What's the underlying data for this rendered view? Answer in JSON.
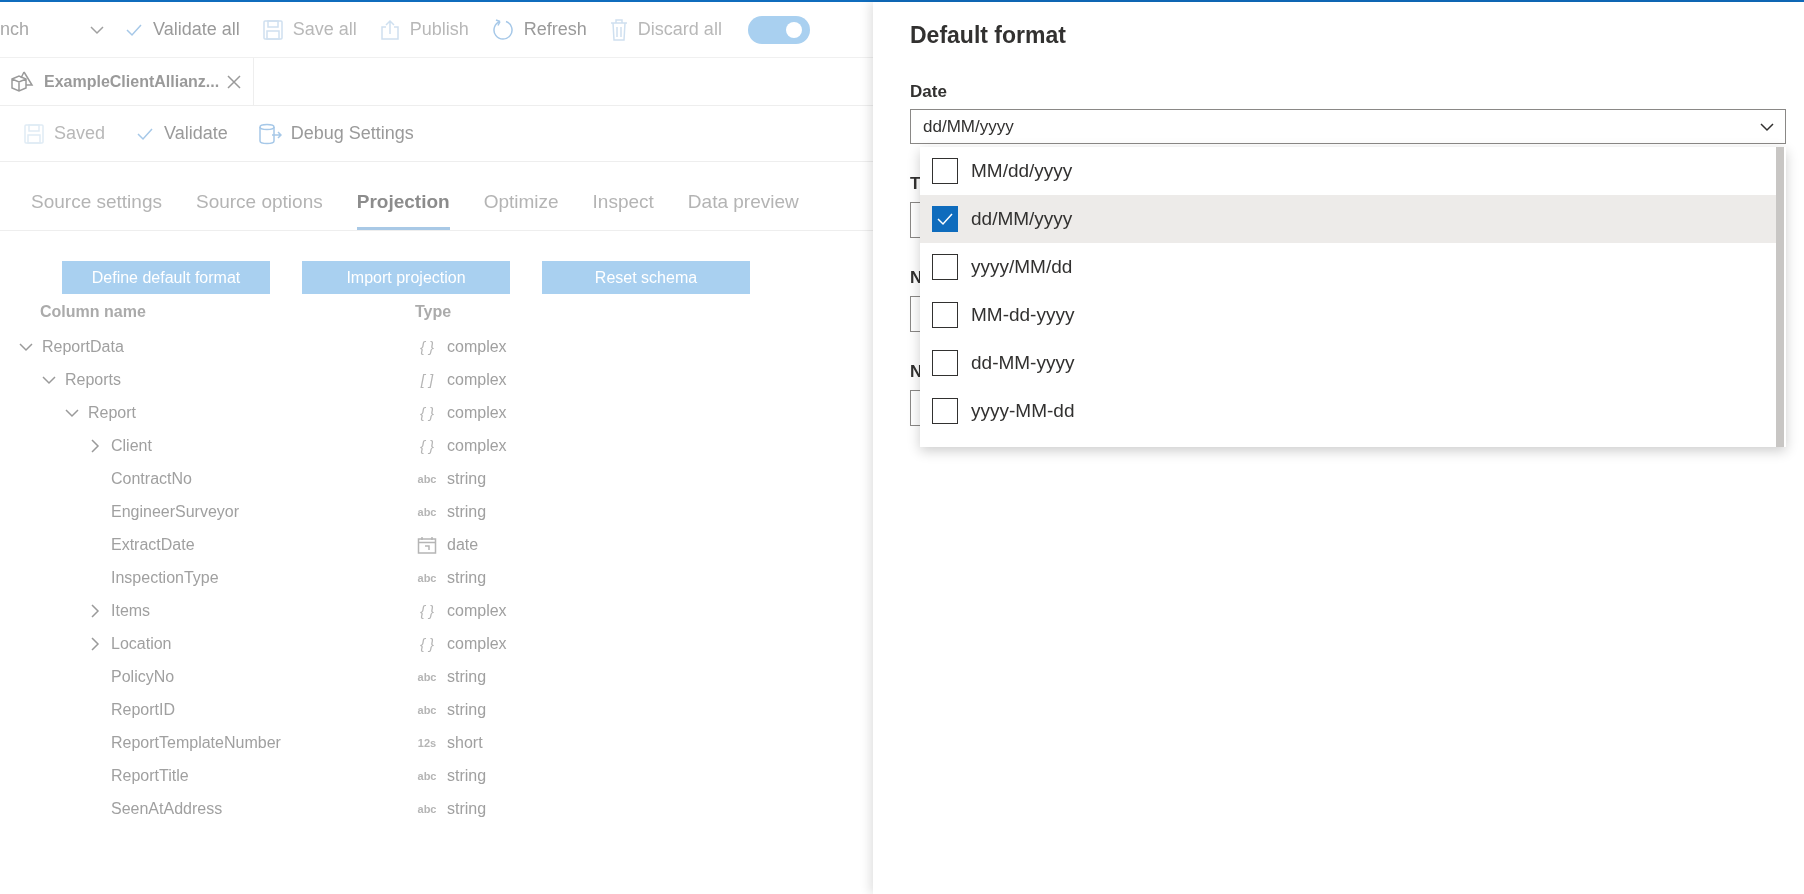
{
  "toolbar": {
    "branch": "nch",
    "items": [
      {
        "kind": "check",
        "label": "Validate all",
        "disabled": false
      },
      {
        "kind": "save",
        "label": "Save all",
        "disabled": true
      },
      {
        "kind": "publish",
        "label": "Publish",
        "disabled": true
      },
      {
        "kind": "refresh",
        "label": "Refresh",
        "disabled": false
      },
      {
        "kind": "trash",
        "label": "Discard all",
        "disabled": true
      }
    ],
    "toggle": {
      "on": true
    }
  },
  "document_tabs": [
    {
      "label": "ExampleClientAllianz...",
      "selected": true
    }
  ],
  "document_toolbar": [
    {
      "kind": "save",
      "label": "Saved",
      "disabled": true
    },
    {
      "kind": "check",
      "label": "Validate",
      "disabled": false
    },
    {
      "kind": "debug",
      "label": "Debug Settings",
      "disabled": false
    }
  ],
  "settings_tabs": [
    {
      "label": "Source settings",
      "selected": false
    },
    {
      "label": "Source options",
      "selected": false
    },
    {
      "label": "Projection",
      "selected": true
    },
    {
      "label": "Optimize",
      "selected": false
    },
    {
      "label": "Inspect",
      "selected": false
    },
    {
      "label": "Data preview",
      "selected": false
    }
  ],
  "actions": [
    {
      "label": "Define default format"
    },
    {
      "label": "Import projection"
    },
    {
      "label": "Reset schema"
    }
  ],
  "projection": {
    "columns": [
      "Column name",
      "Type"
    ],
    "rows": [
      {
        "name": "ReportData",
        "type": "complex",
        "type_icon": {
          "kind": "text",
          "text": "{ }"
        },
        "expanded": true,
        "children": [
          {
            "name": "Reports",
            "type": "complex",
            "type_icon": {
              "kind": "text",
              "text": "[ ]"
            },
            "expanded": true,
            "children": [
              {
                "name": "Report",
                "type": "complex",
                "type_icon": {
                  "kind": "text",
                  "text": "{ }"
                },
                "expanded": true,
                "children": [
                  {
                    "name": "Client",
                    "type": "complex",
                    "type_icon": {
                      "kind": "text",
                      "text": "{ }"
                    },
                    "expanded": false
                  },
                  {
                    "name": "ContractNo",
                    "type": "string",
                    "type_icon": {
                      "kind": "badge",
                      "text": "abc"
                    }
                  },
                  {
                    "name": "EngineerSurveyor",
                    "type": "string",
                    "type_icon": {
                      "kind": "badge",
                      "text": "abc"
                    }
                  },
                  {
                    "name": "ExtractDate",
                    "type": "date",
                    "type_icon": {
                      "kind": "calendar"
                    }
                  },
                  {
                    "name": "InspectionType",
                    "type": "string",
                    "type_icon": {
                      "kind": "badge",
                      "text": "abc"
                    }
                  },
                  {
                    "name": "Items",
                    "type": "complex",
                    "type_icon": {
                      "kind": "text",
                      "text": "{ }"
                    },
                    "expanded": false
                  },
                  {
                    "name": "Location",
                    "type": "complex",
                    "type_icon": {
                      "kind": "text",
                      "text": "{ }"
                    },
                    "expanded": false
                  },
                  {
                    "name": "PolicyNo",
                    "type": "string",
                    "type_icon": {
                      "kind": "badge",
                      "text": "abc"
                    }
                  },
                  {
                    "name": "ReportID",
                    "type": "string",
                    "type_icon": {
                      "kind": "badge",
                      "text": "abc"
                    }
                  },
                  {
                    "name": "ReportTemplateNumber",
                    "type": "short",
                    "type_icon": {
                      "kind": "badge",
                      "text": "12s"
                    }
                  },
                  {
                    "name": "ReportTitle",
                    "type": "string",
                    "type_icon": {
                      "kind": "badge",
                      "text": "abc"
                    }
                  },
                  {
                    "name": "SeenAtAddress",
                    "type": "string",
                    "type_icon": {
                      "kind": "badge",
                      "text": "abc"
                    }
                  }
                ]
              }
            ]
          }
        ]
      }
    ]
  },
  "panel": {
    "title": "Default format",
    "date": {
      "label": "Date",
      "value": "dd/MM/yyyy",
      "options": [
        {
          "label": "MM/dd/yyyy",
          "selected": false
        },
        {
          "label": "dd/MM/yyyy",
          "selected": true
        },
        {
          "label": "yyyy/MM/dd",
          "selected": false
        },
        {
          "label": "MM-dd-yyyy",
          "selected": false
        },
        {
          "label": "dd-MM-yyyy",
          "selected": false
        },
        {
          "label": "yyyy-MM-dd",
          "selected": false
        }
      ]
    },
    "covered_fields": [
      {
        "label": "T"
      },
      {
        "label": "N"
      },
      {
        "label": "N"
      }
    ]
  }
}
